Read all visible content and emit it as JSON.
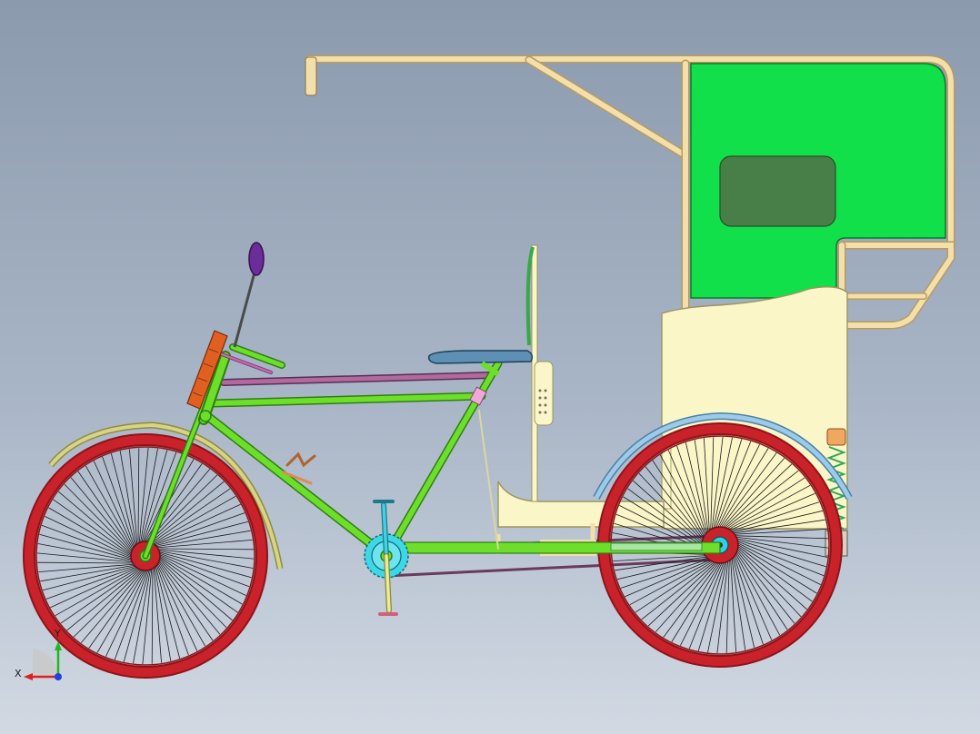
{
  "viewport": {
    "background_top": "#8c9aae",
    "background_bottom": "#d2d9e3"
  },
  "model": {
    "parts": [
      "front-wheel",
      "rear-wheel",
      "front-fender",
      "rear-fender",
      "bicycle-frame",
      "handlebar",
      "headlamp",
      "rear-view-mirror",
      "rider-seat",
      "crank-chainring",
      "pedals",
      "chain",
      "canopy-frame",
      "canopy-panel",
      "canopy-window",
      "passenger-seat",
      "footboard",
      "rear-suspension"
    ],
    "colors": {
      "tire": "#c9222a",
      "tire_dark": "#8d1419",
      "spokes": "#1a1a1a",
      "hub": "#33d1e6",
      "frame": "#6ddf2b",
      "frame_outline": "#2f7d13",
      "crossbar": "#b06a9e",
      "canopy": "#11e04a",
      "canopy_window": "#487f48",
      "tubing": "#f3dfa9",
      "seat_body": "#fbf6c8",
      "fender_front": "#d7d48a",
      "fender_rear": "#86b6d8",
      "rider_seat": "#5e8fb5",
      "headlamp": "#e06022",
      "mirror": "#6a2d9a",
      "chainring": "#3fd7e6"
    }
  },
  "triad": {
    "x_label": "X",
    "y_label": "Y",
    "x_color": "#e02020",
    "y_color": "#1fb81f",
    "z_color": "#2040e0"
  }
}
